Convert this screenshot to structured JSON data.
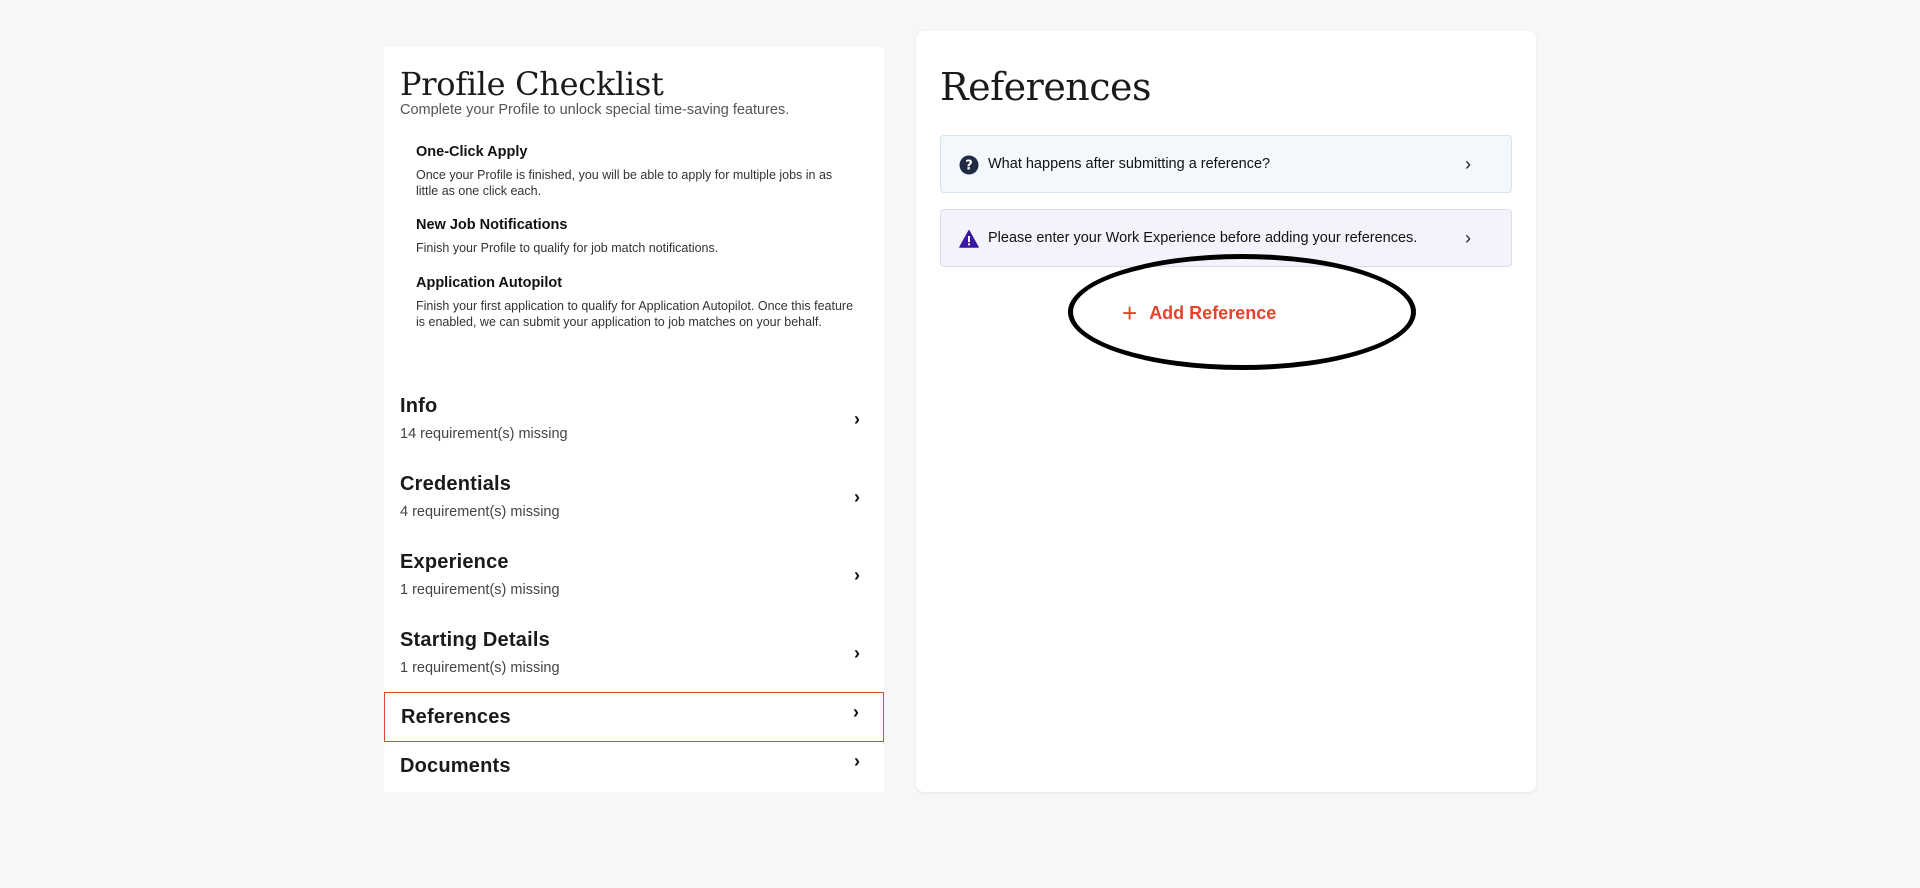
{
  "checklist": {
    "title": "Profile Checklist",
    "subtitle": "Complete your Profile to unlock special time-saving features.",
    "features": [
      {
        "title": "One-Click Apply",
        "description": "Once your Profile is finished, you will be able to apply for multiple jobs in as little as one click each."
      },
      {
        "title": "New Job Notifications",
        "description": "Finish your Profile to qualify for job match notifications."
      },
      {
        "title": "Application Autopilot",
        "description": "Finish your first application to qualify for Application Autopilot. Once this feature is enabled, we can submit your application to job matches on your behalf."
      }
    ],
    "sections": [
      {
        "title": "Info",
        "status": "14 requirement(s) missing"
      },
      {
        "title": "Credentials",
        "status": "4 requirement(s) missing"
      },
      {
        "title": "Experience",
        "status": "1 requirement(s) missing"
      },
      {
        "title": "Starting Details",
        "status": "1 requirement(s) missing"
      },
      {
        "title": "References",
        "status": "",
        "active": true
      },
      {
        "title": "Documents",
        "status": ""
      }
    ],
    "chevron": "›"
  },
  "references": {
    "title": "References",
    "faq_text": "What happens after submitting a reference?",
    "warning_text": "Please enter your Work Experience before adding your references.",
    "add_label": "Add Reference",
    "plus_glyph": "+",
    "chevron": "›"
  },
  "colors": {
    "accent": "#e8432a",
    "active_border": "#e04a2d",
    "faq_icon": "#1f2a44",
    "warn_icon": "#3b14a8"
  }
}
